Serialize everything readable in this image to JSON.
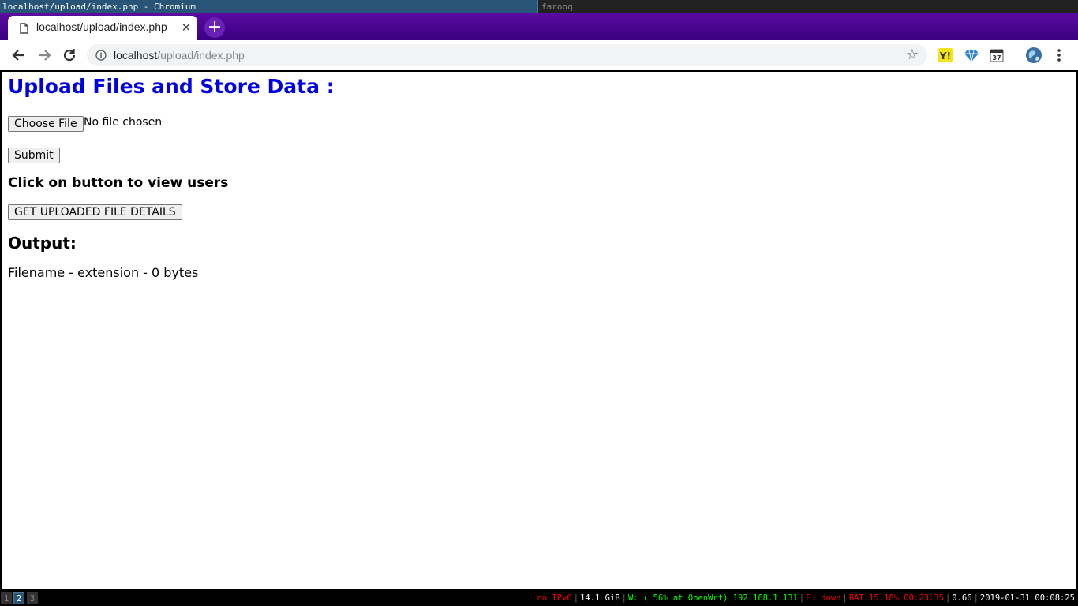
{
  "wm": {
    "active_window_title": "localhost/upload/index.php - Chromium",
    "other_window_title": "farooq"
  },
  "browser": {
    "tab_title": "localhost/upload/index.php",
    "url_host": "localhost",
    "url_path": "/upload/index.php"
  },
  "page": {
    "heading": "Upload Files and Store Data :",
    "choose_file_label": "Choose File",
    "no_file_text": "No file chosen",
    "submit_label": "Submit",
    "view_users_heading": "Click on button to view users",
    "details_button_label": "GET UPLOADED FILE DETAILS",
    "output_heading": "Output:",
    "output_text": "Filename - extension - 0 bytes"
  },
  "statusbar": {
    "workspaces": [
      "1",
      "2",
      "3"
    ],
    "active_workspace": "2",
    "ipv6": "no IPv6",
    "disk": "14.1 GiB",
    "wifi": "W: ( 56% at OpenWrt) 192.168.1.131",
    "ethernet": "E: down",
    "battery": "BAT 15.18% 00:23:35",
    "load": "0.66",
    "datetime": "2019-01-31 00:08:25",
    "colors": {
      "ipv6": "#ff0000",
      "disk": "#ffffff",
      "wifi": "#00ff00",
      "ethernet": "#ff0000",
      "battery": "#ff0000",
      "load": "#ffffff",
      "datetime": "#ffffff"
    }
  },
  "icons": {
    "tab": "document-icon",
    "close": "close-icon",
    "new_tab": "plus-icon",
    "back": "back-arrow-icon",
    "forward": "forward-arrow-icon",
    "reload": "reload-icon",
    "info": "info-icon",
    "bookmark": "star-icon",
    "menu": "kebab-menu-icon"
  }
}
